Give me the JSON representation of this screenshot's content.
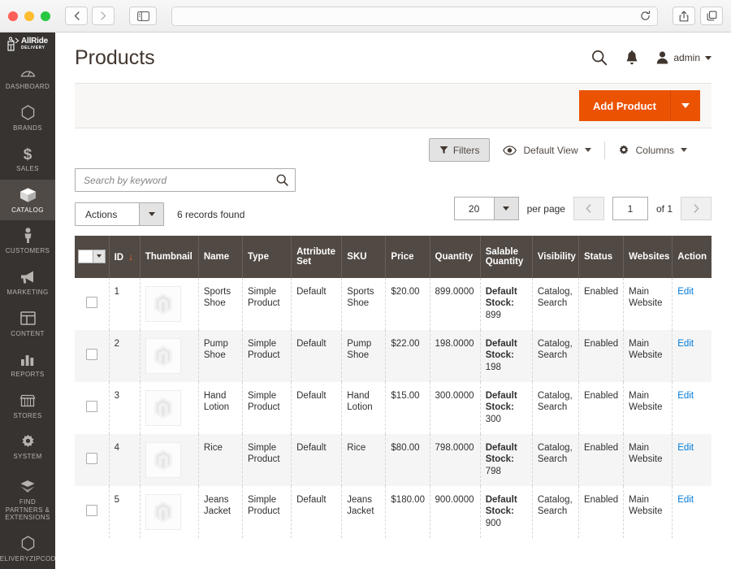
{
  "browser": {
    "back_icon": "chevron-left-icon",
    "forward_icon": "chevron-right-icon",
    "sidebar_icon": "sidebar-toggle-icon",
    "reload_icon": "reload-icon",
    "share_icon": "share-icon",
    "tabs_icon": "tabs-icon",
    "url": ""
  },
  "sidebar": {
    "logo": {
      "name": "AllRide",
      "sub": "DELIVERY"
    },
    "items": [
      {
        "label": "DASHBOARD",
        "icon": "dashboard-icon",
        "active": false
      },
      {
        "label": "BRANDS",
        "icon": "hexagon-icon",
        "active": false
      },
      {
        "label": "SALES",
        "icon": "dollar-icon",
        "active": false
      },
      {
        "label": "CATALOG",
        "icon": "box-icon",
        "active": true
      },
      {
        "label": "CUSTOMERS",
        "icon": "person-icon",
        "active": false
      },
      {
        "label": "MARKETING",
        "icon": "megaphone-icon",
        "active": false
      },
      {
        "label": "CONTENT",
        "icon": "layout-icon",
        "active": false
      },
      {
        "label": "REPORTS",
        "icon": "bar-chart-icon",
        "active": false
      },
      {
        "label": "STORES",
        "icon": "store-icon",
        "active": false
      },
      {
        "label": "SYSTEM",
        "icon": "gear-icon",
        "active": false
      },
      {
        "label": "FIND PARTNERS & EXTENSIONS",
        "icon": "extensions-icon",
        "active": false
      },
      {
        "label": "DELIVERYZIPCODE",
        "icon": "hexagon-icon",
        "active": false
      }
    ]
  },
  "header": {
    "title": "Products",
    "search_icon": "search-icon",
    "notification_icon": "bell-icon",
    "account_icon": "user-icon",
    "account_name": "admin"
  },
  "action_bar": {
    "add_product_label": "Add Product",
    "add_product_caret": "caret-down-icon",
    "accent_color": "#eb5202"
  },
  "grid_toolbar": {
    "filters_label": "Filters",
    "filters_icon": "funnel-icon",
    "view_label": "Default View",
    "view_icon": "eye-icon",
    "columns_label": "Columns",
    "columns_icon": "gear-icon"
  },
  "search": {
    "placeholder": "Search by keyword",
    "value": "",
    "icon": "search-icon"
  },
  "actions": {
    "label": "Actions",
    "records_found": "6 records found"
  },
  "pagination": {
    "per_page_value": "20",
    "per_page_label": "per page",
    "prev_icon": "chevron-left-icon",
    "next_icon": "chevron-right-icon",
    "current_page": "1",
    "of_label": "of 1"
  },
  "table": {
    "columns": [
      "ID",
      "Thumbnail",
      "Name",
      "Type",
      "Attribute Set",
      "SKU",
      "Price",
      "Quantity",
      "Salable Quantity",
      "Visibility",
      "Status",
      "Websites",
      "Action"
    ],
    "sort_column": "ID",
    "sort_arrow": "↓",
    "rows": [
      {
        "id": "1",
        "name": "Sports Shoe",
        "type": "Simple Product",
        "attribute_set": "Default",
        "sku": "Sports Shoe",
        "price": "$20.00",
        "quantity": "899.0000",
        "salable_label": "Default Stock:",
        "salable_value": "899",
        "visibility": "Catalog, Search",
        "status": "Enabled",
        "websites": "Main Website",
        "action": "Edit"
      },
      {
        "id": "2",
        "name": "Pump Shoe",
        "type": "Simple Product",
        "attribute_set": "Default",
        "sku": "Pump Shoe",
        "price": "$22.00",
        "quantity": "198.0000",
        "salable_label": "Default Stock:",
        "salable_value": "198",
        "visibility": "Catalog, Search",
        "status": "Enabled",
        "websites": "Main Website",
        "action": "Edit"
      },
      {
        "id": "3",
        "name": "Hand Lotion",
        "type": "Simple Product",
        "attribute_set": "Default",
        "sku": "Hand Lotion",
        "price": "$15.00",
        "quantity": "300.0000",
        "salable_label": "Default Stock:",
        "salable_value": "300",
        "visibility": "Catalog, Search",
        "status": "Enabled",
        "websites": "Main Website",
        "action": "Edit"
      },
      {
        "id": "4",
        "name": "Rice",
        "type": "Simple Product",
        "attribute_set": "Default",
        "sku": "Rice",
        "price": "$80.00",
        "quantity": "798.0000",
        "salable_label": "Default Stock:",
        "salable_value": "798",
        "visibility": "Catalog, Search",
        "status": "Enabled",
        "websites": "Main Website",
        "action": "Edit"
      },
      {
        "id": "5",
        "name": "Jeans Jacket",
        "type": "Simple Product",
        "attribute_set": "Default",
        "sku": "Jeans Jacket",
        "price": "$180.00",
        "quantity": "900.0000",
        "salable_label": "Default Stock:",
        "salable_value": "900",
        "visibility": "Catalog, Search",
        "status": "Enabled",
        "websites": "Main Website",
        "action": "Edit"
      }
    ]
  }
}
